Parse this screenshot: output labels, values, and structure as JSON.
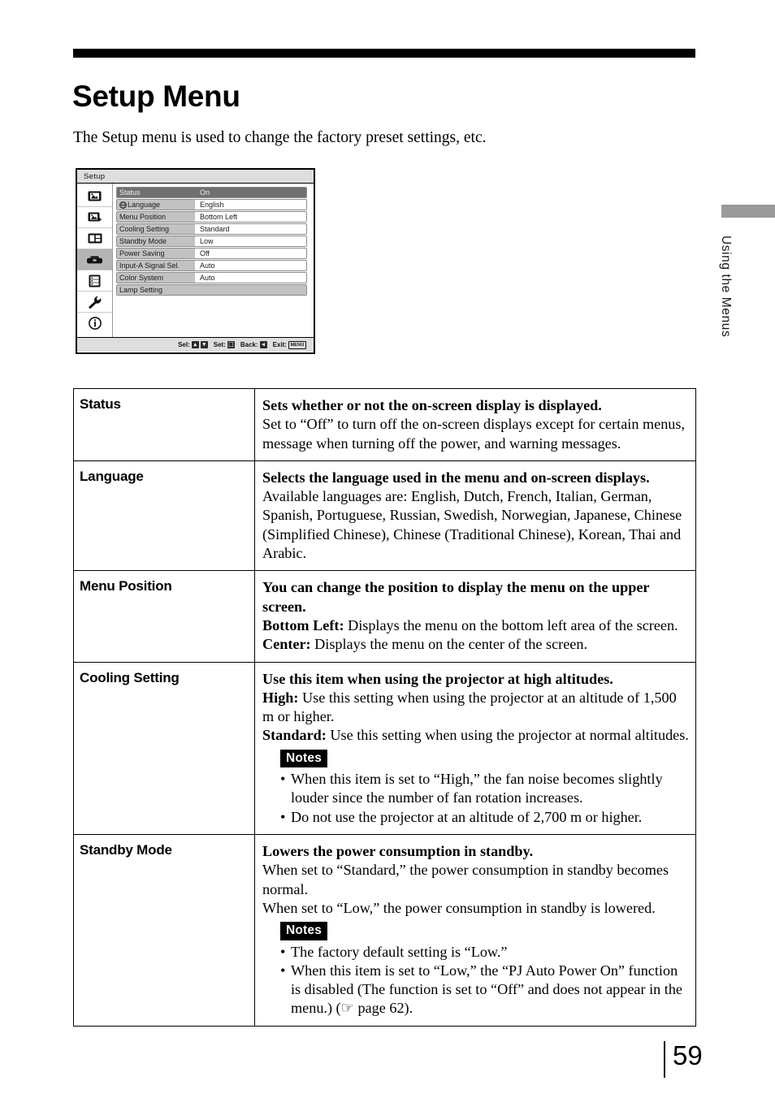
{
  "page": {
    "title": "Setup Menu",
    "intro": "The Setup menu is used to change the factory preset settings, etc.",
    "number": "59",
    "side_tab_label": "Using the Menus"
  },
  "osd": {
    "titlebar": "Setup",
    "sidebar_icons": [
      "picture-icon",
      "picture-add-icon",
      "screen-split-icon",
      "toolbox-icon",
      "function-list-icon",
      "wrench-icon",
      "info-icon"
    ],
    "active_sidebar_index": 3,
    "rows": [
      {
        "label": "Status",
        "value": "On",
        "selected": true,
        "icon": ""
      },
      {
        "label": "Language",
        "value": "English",
        "selected": false,
        "icon": "globe-icon"
      },
      {
        "label": "Menu Position",
        "value": "Bottom Left",
        "selected": false,
        "icon": ""
      },
      {
        "label": "Cooling Setting",
        "value": "Standard",
        "selected": false,
        "icon": ""
      },
      {
        "label": "Standby Mode",
        "value": "Low",
        "selected": false,
        "icon": ""
      },
      {
        "label": "Power Saving",
        "value": "Off",
        "selected": false,
        "icon": ""
      },
      {
        "label": "Input-A Signal Sel.",
        "value": "Auto",
        "selected": false,
        "icon": ""
      },
      {
        "label": "Color System",
        "value": "Auto",
        "selected": false,
        "icon": ""
      },
      {
        "label": "Lamp Setting",
        "value": "",
        "selected": false,
        "icon": "",
        "submenu": true
      }
    ],
    "footer": {
      "sel_label": "Sel:",
      "sel_key_up": "▴",
      "sel_key_down": "▾",
      "set_label": "Set:",
      "set_key": "⬚",
      "back_label": "Back:",
      "back_key": "◂",
      "exit_label": "Exit:",
      "exit_key": "MENU"
    }
  },
  "table": {
    "rows": [
      {
        "key": "Status",
        "headline": "Sets whether or not the on-screen display is displayed.",
        "body": "Set to “Off” to turn off the on-screen displays except for certain menus, message when turning off the power, and warning messages."
      },
      {
        "key": "Language",
        "headline": "Selects the language used in the menu and on-screen displays.",
        "body": "Available languages are: English, Dutch, French, Italian, German, Spanish, Portuguese, Russian, Swedish, Norwegian, Japanese, Chinese (Simplified Chinese), Chinese (Traditional Chinese), Korean, Thai and Arabic."
      },
      {
        "key": "Menu Position",
        "headline": "You can change the position to display the menu on the upper screen.",
        "term1": "Bottom Left:",
        "desc1": " Displays the menu on the bottom left area of the screen.",
        "term2": "Center:",
        "desc2": " Displays the menu on the center of the screen."
      },
      {
        "key": "Cooling Setting",
        "headline": "Use this item when using the projector at high altitudes.",
        "term1": "High:",
        "desc1": " Use this setting when using the projector at an altitude of 1,500 m or higher.",
        "term2": "Standard:",
        "desc2": " Use this setting when using the projector at normal altitudes.",
        "notes_label": "Notes",
        "notes": [
          "When this item is set to “High,” the fan noise becomes slightly louder since the number of fan rotation increases.",
          "Do not use the projector at an altitude of 2,700 m or higher."
        ]
      },
      {
        "key": "Standby Mode",
        "headline": "Lowers the power consumption in standby.",
        "body1": "When set to “Standard,” the power consumption in standby becomes normal.",
        "body2": "When set to “Low,” the power consumption in standby is lowered.",
        "notes_label": "Notes",
        "notes": [
          "The factory default setting is “Low.”",
          "When this item is set to “Low,” the “PJ Auto Power On” function is disabled (The function is set to “Off” and does not appear in the menu.) (☞ page 62)."
        ]
      }
    ]
  }
}
